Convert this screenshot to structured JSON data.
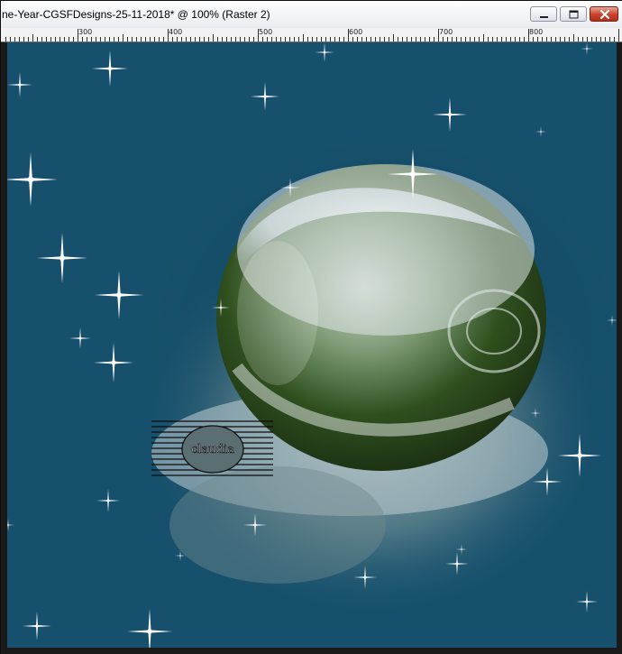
{
  "window": {
    "title": "ne-Year-CGSFDesigns-25-11-2018* @ 100% (Raster 2)",
    "buttons": {
      "minimize": "minimize-icon",
      "maximize": "maximize-icon",
      "close": "close-icon"
    }
  },
  "ruler": {
    "labels": [
      "300",
      "400",
      "500",
      "600",
      "700",
      "800"
    ]
  },
  "canvas": {
    "background_color": "#17506c",
    "watermark_text": "claudia"
  }
}
